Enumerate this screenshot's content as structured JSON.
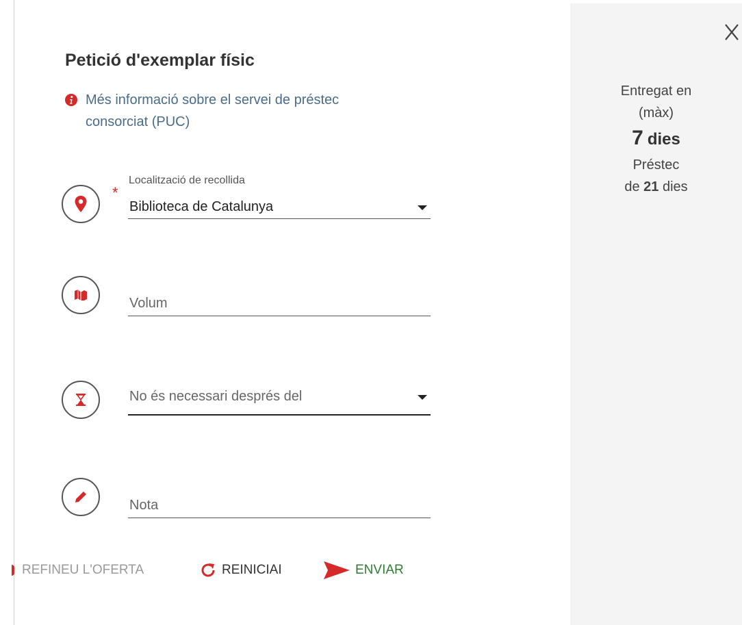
{
  "dialog": {
    "title": "Petició d'exemplar físic",
    "info_link_line1": "Més informació sobre el servei de préstec",
    "info_link_line2": "consorciat (PUC)"
  },
  "fields": {
    "location": {
      "label": "Localització de recollida",
      "value": "Biblioteca de Catalunya",
      "required_mark": "*"
    },
    "volume": {
      "placeholder": "Volum"
    },
    "not_needed_after": {
      "placeholder": "No és necessari després del"
    },
    "note": {
      "placeholder": "Nota"
    }
  },
  "actions": {
    "refine": "REFINEU L'OFERTA",
    "reset": "REINICIAI",
    "send": "ENVIAR"
  },
  "delivery": {
    "line1": "Entregat en",
    "line2": "(màx)",
    "days_number": "7",
    "days_unit": "dies",
    "loan_label": "Préstec",
    "loan_prefix": "de",
    "loan_days": "21",
    "loan_suffix": "dies"
  },
  "colors": {
    "accent_red": "#d62929",
    "link_blue": "#4a6c8a",
    "send_green": "#2e7d32",
    "panel_bg": "#f4f4f4"
  },
  "icons": {
    "location": "map-marker-icon",
    "volume": "books-icon",
    "date": "hourglass-icon",
    "note": "pencil-icon",
    "info": "info-circle-icon",
    "reset": "refresh-icon",
    "send": "paper-plane-icon",
    "close": "close-icon"
  }
}
